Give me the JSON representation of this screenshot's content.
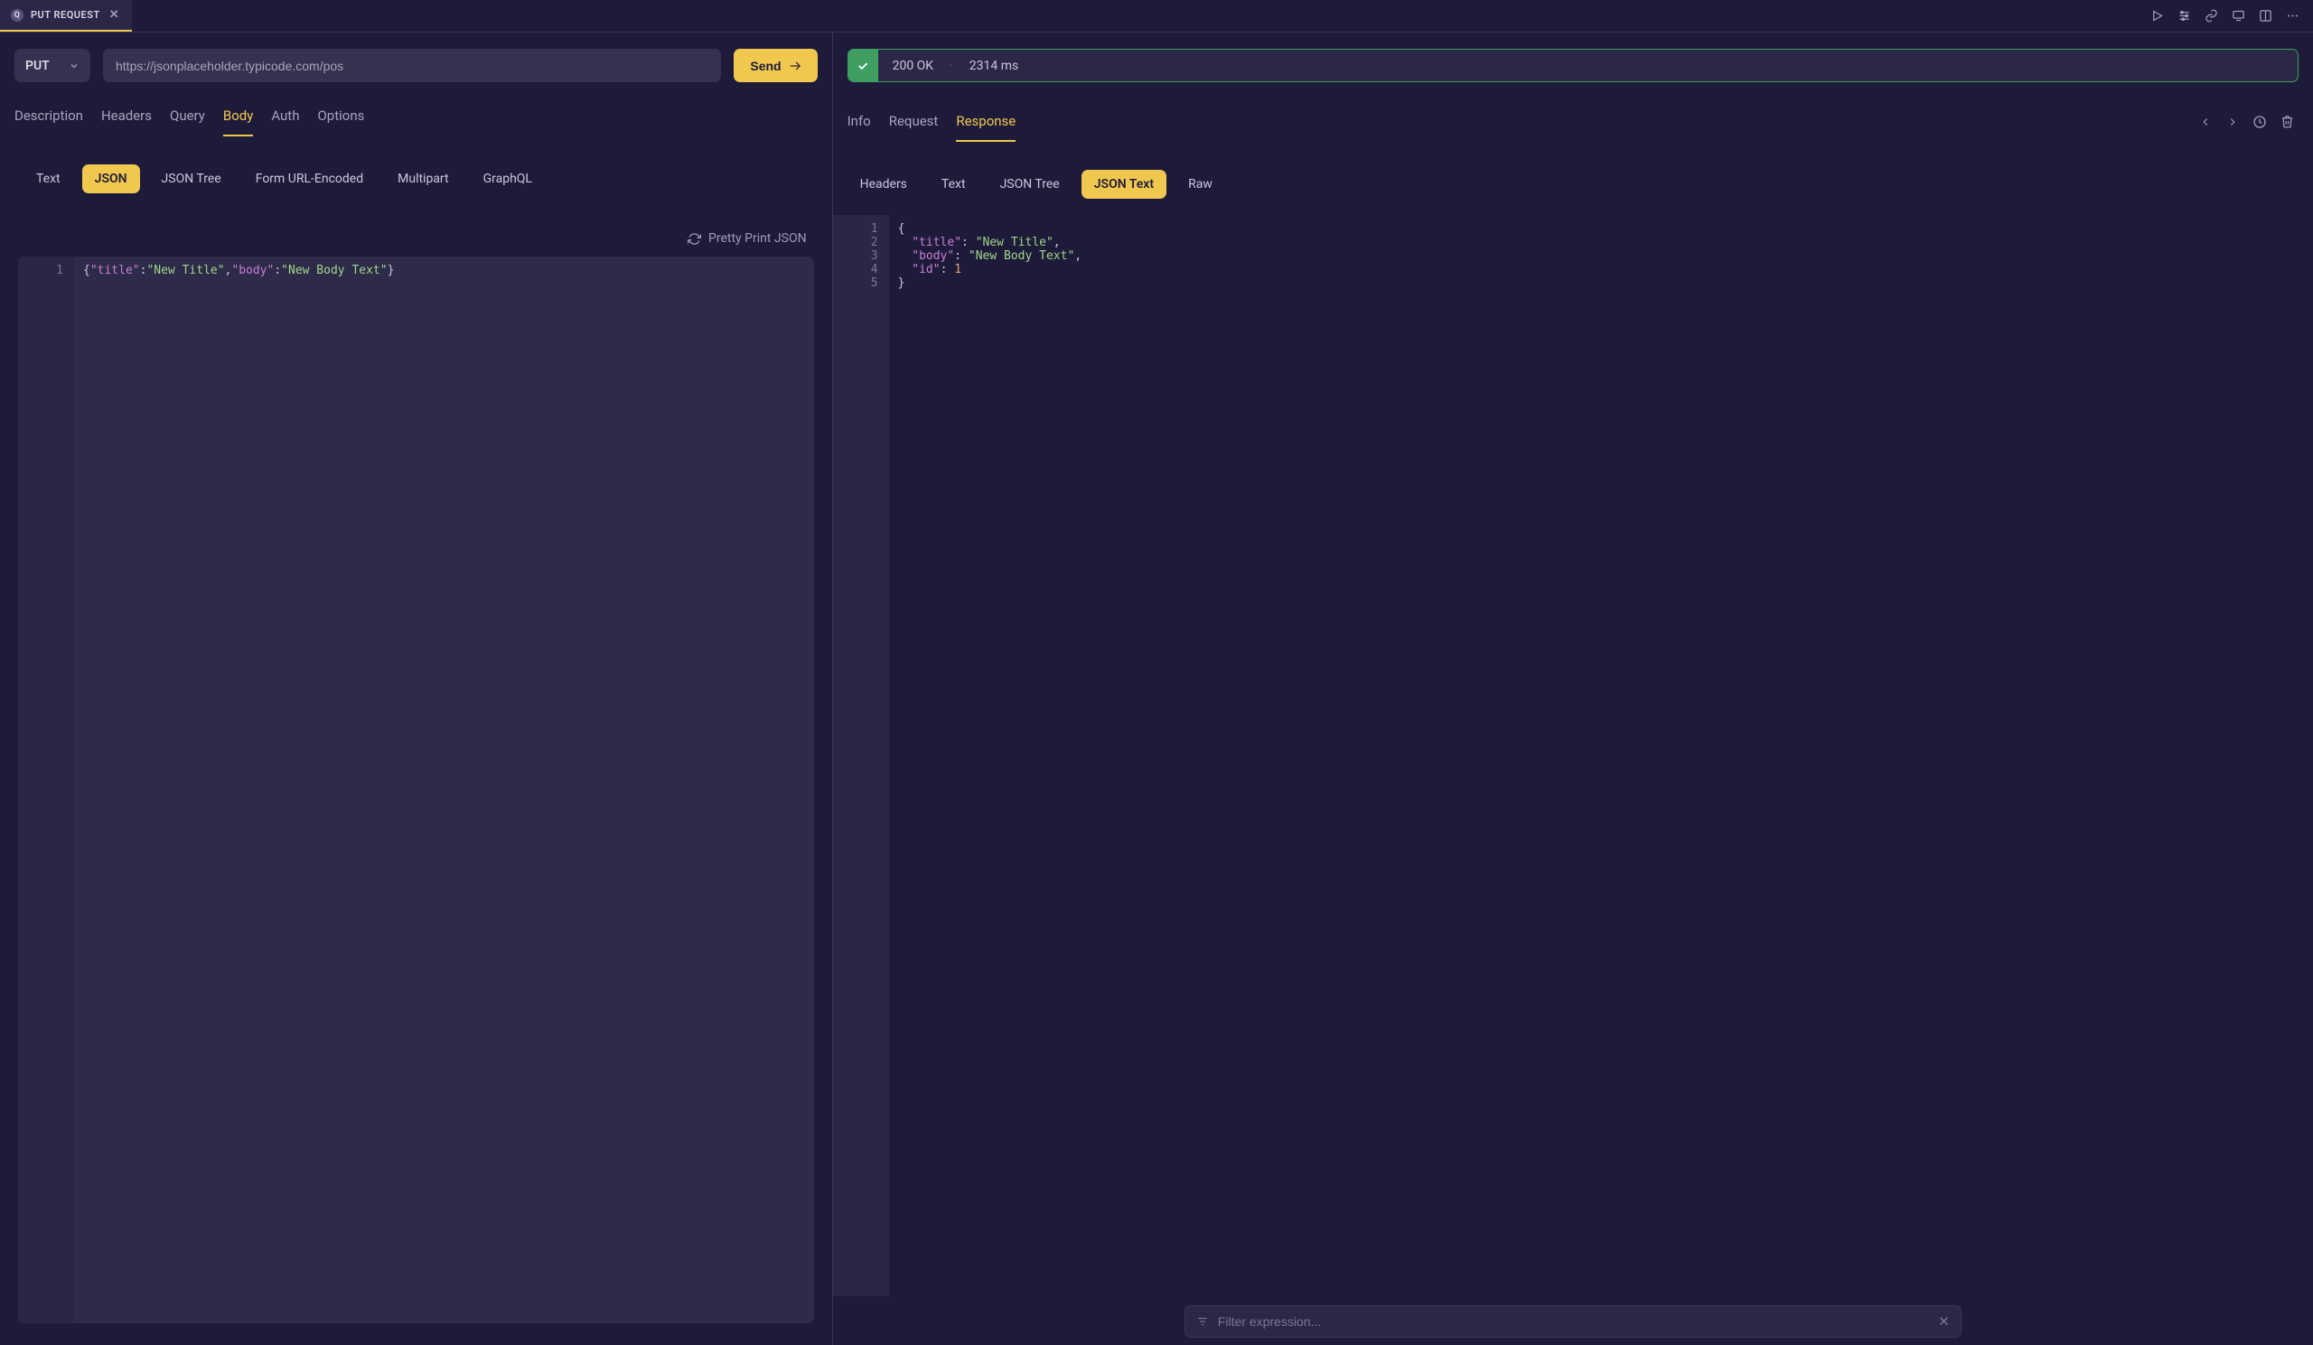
{
  "document_tab": {
    "title": "PUT REQUEST"
  },
  "request": {
    "method": "PUT",
    "url": "https://jsonplaceholder.typicode.com/pos",
    "send_label": "Send"
  },
  "left_tabs": [
    "Description",
    "Headers",
    "Query",
    "Body",
    "Auth",
    "Options"
  ],
  "left_tabs_active": "Body",
  "body_types": [
    "Text",
    "JSON",
    "JSON Tree",
    "Form URL-Encoded",
    "Multipart",
    "GraphQL"
  ],
  "body_types_active": "JSON",
  "pretty_print_label": "Pretty Print JSON",
  "body_editor_line": 1,
  "status": {
    "code": "200 OK",
    "time": "2314 ms"
  },
  "right_tabs": [
    "Info",
    "Request",
    "Response"
  ],
  "right_tabs_active": "Response",
  "response_views": [
    "Headers",
    "Text",
    "JSON Tree",
    "JSON Text",
    "Raw"
  ],
  "response_views_active": "JSON Text",
  "chart_data": {
    "type": "table",
    "request_body": {
      "title": "New Title",
      "body": "New Body Text"
    },
    "response_body": {
      "title": "New Title",
      "body": "New Body Text",
      "id": 1
    }
  },
  "response_line_numbers": [
    "1",
    "2",
    "3",
    "4",
    "5"
  ],
  "filter_placeholder": "Filter expression..."
}
